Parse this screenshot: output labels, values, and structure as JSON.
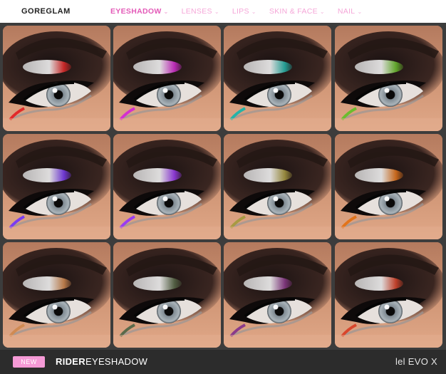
{
  "header": {
    "brand": "GOREGLAM",
    "nav": [
      {
        "label": "EYESHADOW",
        "active": true
      },
      {
        "label": "LENSES",
        "active": false
      },
      {
        "label": "LIPS",
        "active": false
      },
      {
        "label": "SKIN & FACE",
        "active": false
      },
      {
        "label": "NAIL",
        "active": false
      }
    ]
  },
  "swatches": [
    {
      "color": "#e22a2a"
    },
    {
      "color": "#d42fd0"
    },
    {
      "color": "#24b3a8"
    },
    {
      "color": "#6bbd2e"
    },
    {
      "color": "#7a3cf0"
    },
    {
      "color": "#9a3cf0"
    },
    {
      "color": "#a89a42"
    },
    {
      "color": "#e2741c"
    },
    {
      "color": "#d08a52"
    },
    {
      "color": "#5a6a4a"
    },
    {
      "color": "#8a3a8a"
    },
    {
      "color": "#d8462c"
    }
  ],
  "footer": {
    "badge": "NEW",
    "product_name": "RIDER",
    "product_type": "EYESHADOW",
    "compat": "lel EVO X"
  }
}
